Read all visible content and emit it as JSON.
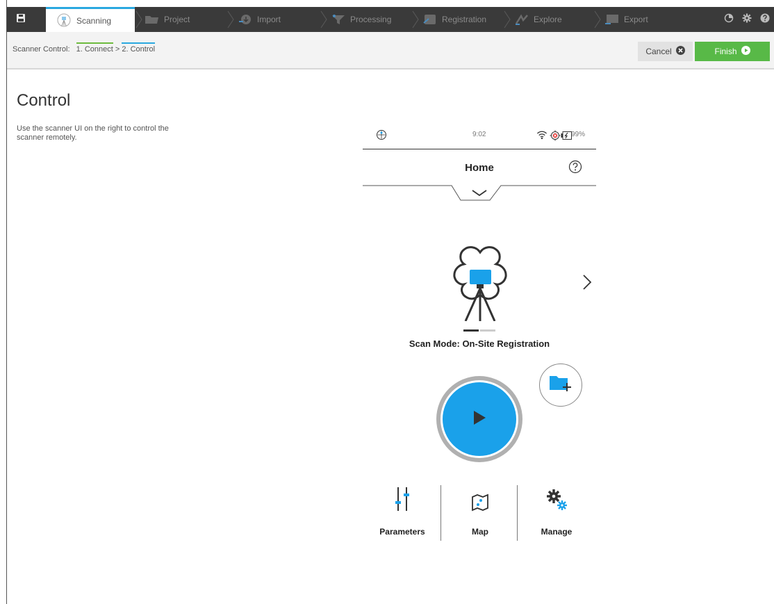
{
  "tabs": [
    {
      "label": "Scanning",
      "icon": "scanner-icon",
      "active": true
    },
    {
      "label": "Project",
      "icon": "folder-icon",
      "active": false
    },
    {
      "label": "Import",
      "icon": "import-icon",
      "active": false
    },
    {
      "label": "Processing",
      "icon": "funnel-icon",
      "active": false
    },
    {
      "label": "Registration",
      "icon": "registration-icon",
      "active": false
    },
    {
      "label": "Explore",
      "icon": "explore-icon",
      "active": false
    },
    {
      "label": "Export",
      "icon": "monitor-export-icon",
      "active": false
    }
  ],
  "subbar": {
    "label": "Scanner Control:",
    "step1": "1. Connect",
    "separator": ">",
    "step2": "2. Control",
    "cancel_label": "Cancel",
    "finish_label": "Finish"
  },
  "main": {
    "title": "Control",
    "description": "Use the scanner UI on the right to control the scanner remotely."
  },
  "scanner": {
    "time": "9:02",
    "battery": "99%",
    "home_title": "Home",
    "scan_mode": "Scan Mode: On-Site Registration",
    "nav": [
      {
        "label": "Parameters",
        "icon": "sliders-icon"
      },
      {
        "label": "Map",
        "icon": "map-icon"
      },
      {
        "label": "Manage",
        "icon": "gears-icon"
      }
    ]
  },
  "colors": {
    "accent_blue": "#1aa1ea",
    "finish_green": "#58b947",
    "topbar_dark": "#3a3a3a"
  }
}
